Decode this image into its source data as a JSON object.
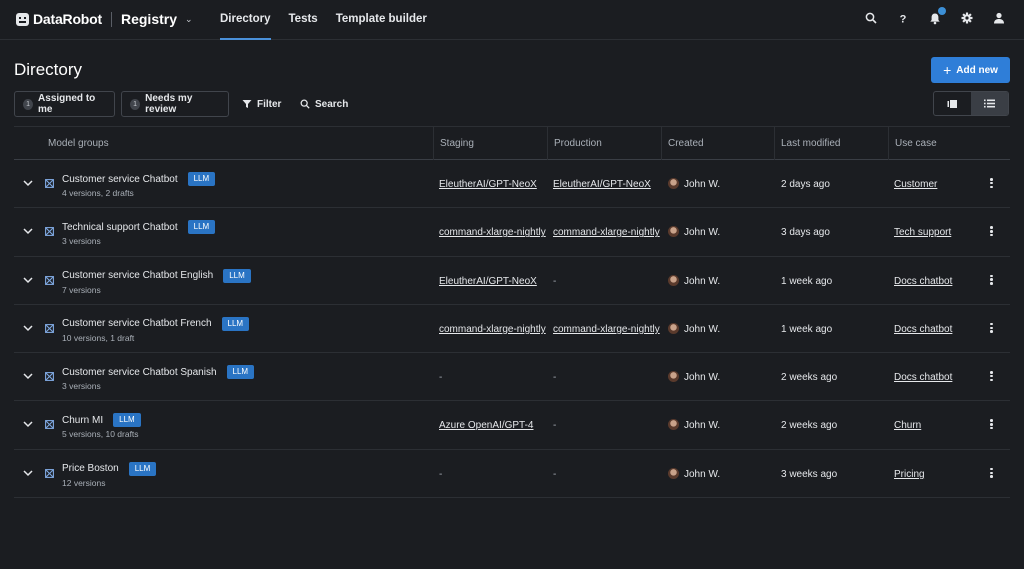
{
  "app": {
    "brand": "DataRobot",
    "product": "Registry",
    "tabs": [
      {
        "label": "Directory",
        "active": true
      },
      {
        "label": "Tests",
        "active": false
      },
      {
        "label": "Template builder",
        "active": false
      }
    ],
    "icons": [
      "search-icon",
      "help-icon",
      "notifications-icon",
      "settings-icon",
      "user-icon"
    ]
  },
  "page": {
    "title": "Directory",
    "add_button": "Add new"
  },
  "filters": {
    "assigned": {
      "count": "1",
      "label": "Assigned to me"
    },
    "review": {
      "count": "1",
      "label": "Needs my review"
    },
    "filter_label": "Filter",
    "search_label": "Search"
  },
  "table": {
    "headers": [
      "Model groups",
      "Staging",
      "Production",
      "Created",
      "Last modified",
      "Use case"
    ],
    "rows": [
      {
        "name": "Customer service Chatbot",
        "tag": "LLM",
        "sub": "4 versions, 2 drafts",
        "staging": "EleutherAI/GPT-NeoX",
        "production": "EleutherAI/GPT-NeoX",
        "created": "John W.",
        "modified": "2 days ago",
        "use_case": "Customer"
      },
      {
        "name": "Technical support Chatbot",
        "tag": "LLM",
        "sub": "3 versions",
        "staging": "command-xlarge-nightly",
        "production": "command-xlarge-nightly",
        "created": "John W.",
        "modified": "3 days ago",
        "use_case": "Tech support"
      },
      {
        "name": "Customer service Chatbot English",
        "tag": "LLM",
        "sub": "7 versions",
        "staging": "EleutherAI/GPT-NeoX",
        "production": "-",
        "created": "John W.",
        "modified": "1 week ago",
        "use_case": "Docs chatbot"
      },
      {
        "name": "Customer service Chatbot French",
        "tag": "LLM",
        "sub": "10 versions, 1 draft",
        "staging": "command-xlarge-nightly",
        "production": "command-xlarge-nightly",
        "created": "John W.",
        "modified": "1 week ago",
        "use_case": "Docs chatbot"
      },
      {
        "name": "Customer service Chatbot Spanish",
        "tag": "LLM",
        "sub": "3 versions",
        "staging": "-",
        "production": "-",
        "created": "John W.",
        "modified": "2 weeks ago",
        "use_case": "Docs chatbot"
      },
      {
        "name": "Churn MI",
        "tag": "LLM",
        "sub": "5 versions, 10 drafts",
        "staging": "Azure OpenAI/GPT-4",
        "production": "-",
        "created": "John W.",
        "modified": "2 weeks ago",
        "use_case": "Churn"
      },
      {
        "name": "Price Boston",
        "tag": "LLM",
        "sub": "12 versions",
        "staging": "-",
        "production": "-",
        "created": "John W.",
        "modified": "3 weeks ago",
        "use_case": "Pricing"
      }
    ]
  },
  "colors": {
    "background": "#1b1d21",
    "accent": "#2f7ed8",
    "tag": "#2a74c4"
  }
}
